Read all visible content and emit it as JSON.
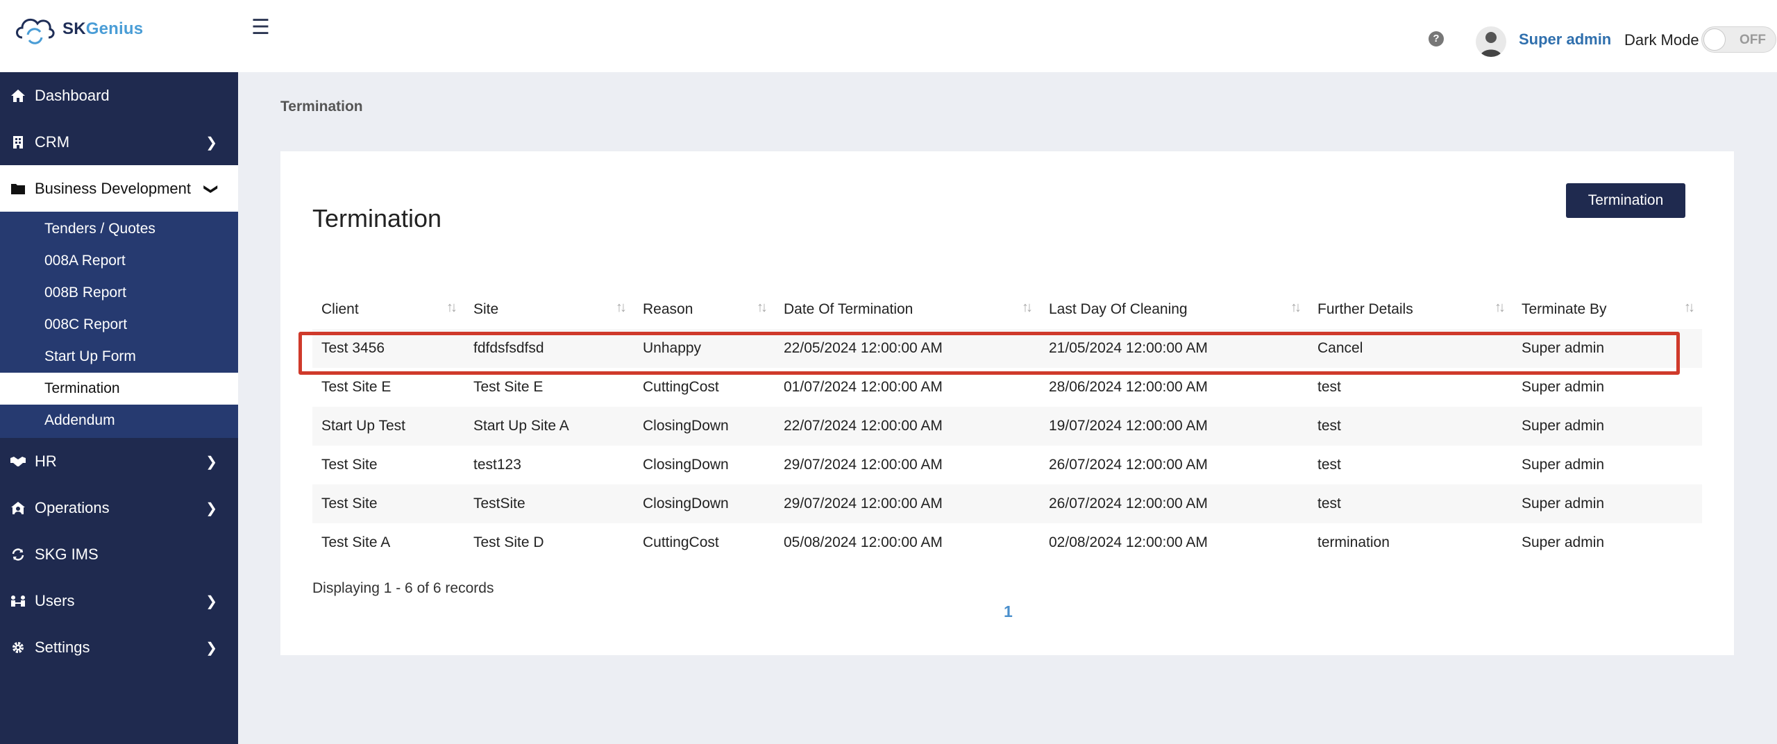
{
  "header": {
    "logo_text_sk": "SK",
    "logo_text_genius": "Genius",
    "user_name": "Super admin",
    "dark_mode_label": "Dark Mode",
    "dark_mode_state": "OFF"
  },
  "sidebar": {
    "items": [
      {
        "label": "Dashboard",
        "icon": "home-icon"
      },
      {
        "label": "CRM",
        "icon": "building-icon"
      },
      {
        "label": "Business Development",
        "icon": "folder-icon"
      },
      {
        "label": "HR",
        "icon": "handshake-icon"
      },
      {
        "label": "Operations",
        "icon": "house-user-icon"
      },
      {
        "label": "SKG IMS",
        "icon": "sync-icon"
      },
      {
        "label": "Users",
        "icon": "users-icon"
      },
      {
        "label": "Settings",
        "icon": "gear-icon"
      }
    ],
    "sub_items": [
      "Tenders / Quotes",
      "008A Report",
      "008B Report",
      "008C Report",
      "Start Up Form",
      "Termination",
      "Addendum"
    ]
  },
  "main": {
    "breadcrumb": "Termination",
    "title": "Termination",
    "button_label": "Termination",
    "columns": [
      "Client",
      "Site",
      "Reason",
      "Date Of Termination",
      "Last Day Of Cleaning",
      "Further Details",
      "Terminate By"
    ],
    "rows": [
      [
        "Test 3456",
        "fdfdsfsdfsd",
        "Unhappy",
        "22/05/2024 12:00:00 AM",
        "21/05/2024 12:00:00 AM",
        "Cancel",
        "Super admin"
      ],
      [
        "Test Site E",
        "Test Site E",
        "CuttingCost",
        "01/07/2024 12:00:00 AM",
        "28/06/2024 12:00:00 AM",
        "test",
        "Super admin"
      ],
      [
        "Start Up Test",
        "Start Up Site A",
        "ClosingDown",
        "22/07/2024 12:00:00 AM",
        "19/07/2024 12:00:00 AM",
        "test",
        "Super admin"
      ],
      [
        "Test Site",
        "test123",
        "ClosingDown",
        "29/07/2024 12:00:00 AM",
        "26/07/2024 12:00:00 AM",
        "test",
        "Super admin"
      ],
      [
        "Test Site",
        "TestSite",
        "ClosingDown",
        "29/07/2024 12:00:00 AM",
        "26/07/2024 12:00:00 AM",
        "test",
        "Super admin"
      ],
      [
        "Test Site A",
        "Test Site D",
        "CuttingCost",
        "05/08/2024 12:00:00 AM",
        "02/08/2024 12:00:00 AM",
        "termination",
        "Super admin"
      ]
    ],
    "footer_text": "Displaying 1 - 6 of 6 records",
    "page_number": "1"
  },
  "colors": {
    "sidebar_bg": "#1f2a4f",
    "submenu_bg": "#263a70",
    "accent_blue": "#2f6fad",
    "highlight_red": "#cf3a2b"
  }
}
